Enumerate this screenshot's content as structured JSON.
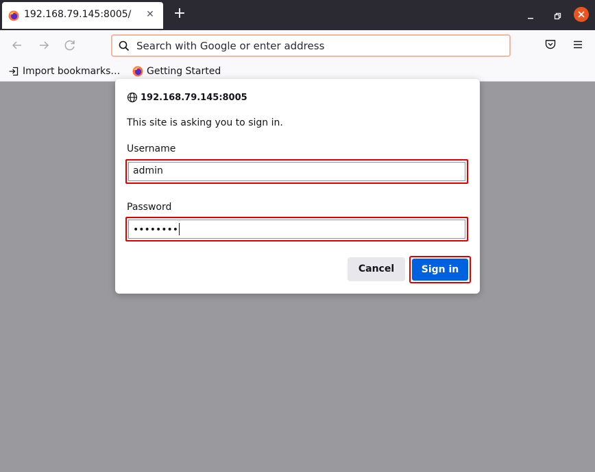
{
  "tab": {
    "title": "192.168.79.145:8005/",
    "favicon": "firefox-icon",
    "close_icon": "close-icon"
  },
  "toolbar": {
    "new_tab_icon": "plus-icon",
    "back_icon": "arrow-left-icon",
    "forward_icon": "arrow-right-icon",
    "reload_icon": "reload-icon",
    "pocket_icon": "pocket-icon",
    "menu_icon": "hamburger-icon"
  },
  "urlbar": {
    "placeholder": "Search with Google or enter address",
    "icon": "search-icon"
  },
  "bookmarks": {
    "items": [
      {
        "label": "Import bookmarks…",
        "icon": "import-icon"
      },
      {
        "label": "Getting Started",
        "icon": "firefox-icon"
      }
    ]
  },
  "dialog": {
    "origin": "192.168.79.145:8005",
    "message": "This site is asking you to sign in.",
    "username_label": "Username",
    "username_value": "admin",
    "password_label": "Password",
    "password_value": "••••••••",
    "cancel_label": "Cancel",
    "signin_label": "Sign in"
  },
  "colors": {
    "accent": "#0061e0",
    "highlight": "#e00000",
    "close_window": "#e95420",
    "titlebar": "#2b2a33"
  }
}
